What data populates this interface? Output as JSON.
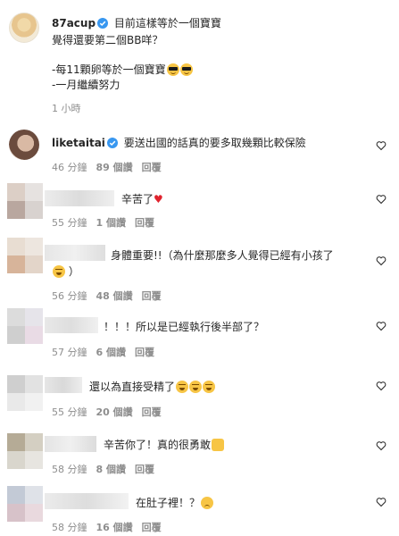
{
  "post": {
    "username": "87acup",
    "caption_line1": "目前這樣等於一個寶寶",
    "caption_line2": "覺得還要第二個BB咩？",
    "caption_line3": "-每11顆卵等於一個寶寶",
    "caption_line4": "-一月繼續努力",
    "time": "1 小時"
  },
  "comments": [
    {
      "username": "liketaitai",
      "text": "要送出國的話真的要多取幾顆比較保險",
      "time": "46 分鐘",
      "likes": "89 個讚",
      "reply": "回覆"
    },
    {
      "username": "",
      "text": "辛苦了",
      "time": "55 分鐘",
      "likes": "1 個讚",
      "reply": "回覆"
    },
    {
      "username": "",
      "text": "身體重要!!（為什麼那麼多人覺得已經有小孩了",
      "text2": "）",
      "time": "56 分鐘",
      "likes": "48 個讚",
      "reply": "回覆"
    },
    {
      "username": "",
      "text": "！！！所以是已經執行後半部了？",
      "time": "57 分鐘",
      "likes": "6 個讚",
      "reply": "回覆"
    },
    {
      "username": "",
      "text": "還以為直接受精了",
      "time": "55 分鐘",
      "likes": "20 個讚",
      "reply": "回覆"
    },
    {
      "username": "",
      "text": "辛苦你了！真的很勇敢",
      "time": "58 分鐘",
      "likes": "8 個讚",
      "reply": "回覆"
    },
    {
      "username": "",
      "text": "在肚子裡！？",
      "time": "58 分鐘",
      "likes": "16 個讚",
      "reply": "回覆"
    }
  ],
  "colors": {
    "verified": "#3897f0",
    "muted": "#8e8e8e",
    "heart": "#e0232e"
  }
}
